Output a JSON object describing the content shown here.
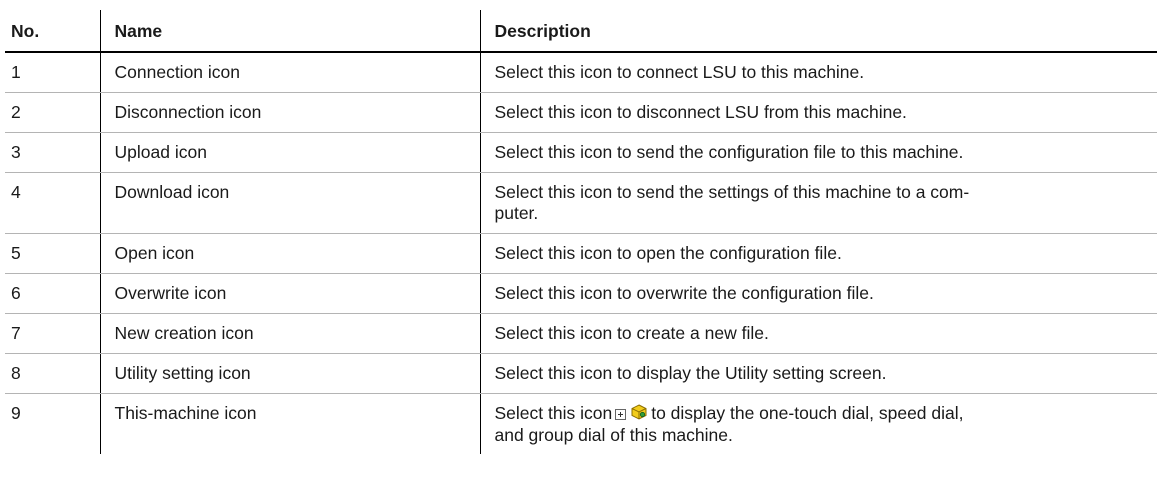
{
  "table": {
    "headers": {
      "no": "No.",
      "name": "Name",
      "description": "Description"
    },
    "rows": [
      {
        "no": "1",
        "name": "Connection icon",
        "description": "Select this icon to connect LSU to this machine."
      },
      {
        "no": "2",
        "name": "Disconnection icon",
        "description": "Select this icon to disconnect LSU from this machine."
      },
      {
        "no": "3",
        "name": "Upload icon",
        "description": "Select this icon to send the configuration file to this machine."
      },
      {
        "no": "4",
        "name": "Download icon",
        "description": "Select this icon to send the settings of this machine to a com-",
        "description_line2": "puter."
      },
      {
        "no": "5",
        "name": "Open icon",
        "description": "Select this icon to open the configuration file."
      },
      {
        "no": "6",
        "name": "Overwrite icon",
        "description": "Select this icon to overwrite the configuration file."
      },
      {
        "no": "7",
        "name": "New creation icon",
        "description": "Select this icon to create a new file."
      },
      {
        "no": "8",
        "name": "Utility setting icon",
        "description": "Select this icon to display the Utility setting screen."
      },
      {
        "no": "9",
        "name": "This-machine icon",
        "description_before_icon": "Select this icon",
        "description_after_icon": "to display the one-touch dial, speed dial,",
        "description_line2": "and group dial of this machine.",
        "inline_icons": [
          "expand-plus-icon",
          "this-machine-icon"
        ]
      }
    ]
  },
  "colors": {
    "text": "#1a1a1a",
    "rule": "#000000",
    "row_divider": "#b4b4b4",
    "icon_yellow": "#f2cc1b"
  }
}
